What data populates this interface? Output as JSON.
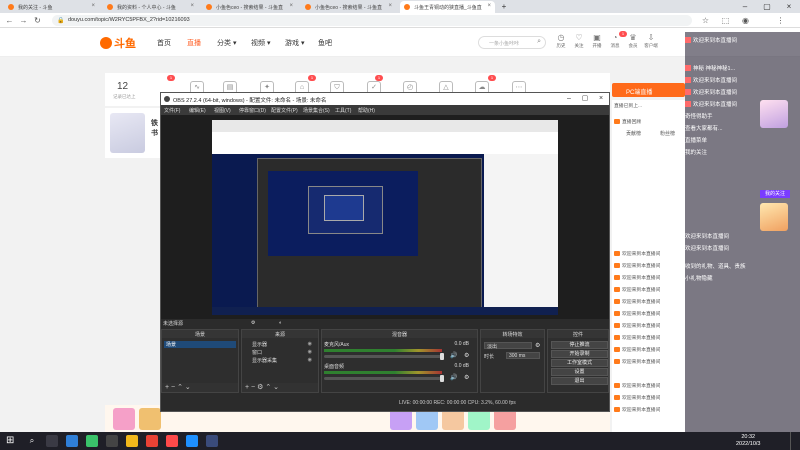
{
  "browser": {
    "tabs": [
      {
        "title": "我的关注 - 斗鱼"
      },
      {
        "title": "我的资料 - 个人中心 - 斗鱼"
      },
      {
        "title": "小鱼色ceo - 搜索结果 - 斗鱼直"
      },
      {
        "title": "小鱼色ceo - 搜索结果 - 斗鱼直"
      },
      {
        "title": "斗鱼王青铜动的狭直播_斗鱼直"
      }
    ],
    "url": "douyu.com/topic/W2RYC5PFBX_2?rid=10216093"
  },
  "site": {
    "logo": "斗鱼",
    "nav": [
      "首页",
      "直播",
      "分类",
      "视频",
      "游戏",
      "鱼吧"
    ],
    "nav_active": "直播",
    "search_placeholder": "一条小鱼咔咔",
    "header_icons": [
      "历史",
      "关注",
      "开播",
      "消息",
      "会员",
      "客户端"
    ],
    "header_badge": "1"
  },
  "streamer": {
    "number": "12",
    "number_label": "记录已达上",
    "name": "铁书",
    "tool_badges": [
      "1",
      "1",
      "1",
      "1"
    ],
    "right_button": "PC端直播"
  },
  "right_panel": {
    "top_note": "直播已到上...",
    "tabs": [
      "贡献榜",
      "粉丝榜"
    ],
    "messages": [
      "直播回顾",
      "欢迎来到本直播间",
      "欢迎来到本直播间",
      "欢迎来到本直播间",
      "欢迎来到本直播间",
      "欢迎来到本直播间",
      "欢迎来到本直播间",
      "欢迎来到本直播间",
      "欢迎来到本直播间",
      "欢迎来到本直播间",
      "欢迎来到本直播间",
      "欢迎来到本直播间",
      "欢迎来到本直播间",
      "欢迎来到本直播间"
    ]
  },
  "overlay": {
    "lines": [
      "欢迎来到本直播间",
      "神秘 神秘神秘1...",
      "欢迎来到本直播间",
      "欢迎来到本直播间",
      "欢迎来到本直播间",
      "奇怪得助手",
      "查看大家都有...",
      "直播菜单",
      "我的关注",
      "欢迎来到本直播间",
      "欢迎来到本直播间",
      "收到的礼物、道具、贵族",
      "小礼物隐藏"
    ],
    "side_label": "我的关注"
  },
  "obs": {
    "title": "OBS 27.2.4 (64-bit, windows) - 配置文件: 未命名 - 场景: 未命名",
    "menu": [
      "文件(F)",
      "编辑(E)",
      "视图(V)",
      "停靠窗口(D)",
      "配置文件(P)",
      "场景集合(S)",
      "工具(T)",
      "帮助(H)"
    ],
    "preview_label": "未选择源",
    "docks": {
      "scenes": {
        "title": "场景",
        "items": [
          "场景"
        ]
      },
      "sources": {
        "title": "来源",
        "items": [
          "显示器",
          "窗口",
          "显示器采集"
        ]
      },
      "mixer": {
        "title": "混音器",
        "channels": [
          {
            "name": "麦克风/Aux",
            "db": "0.0 dB"
          },
          {
            "name": "桌面音频",
            "db": "0.0 dB"
          }
        ]
      },
      "transitions": {
        "title": "转场特效",
        "type": "淡出",
        "duration_label": "时长",
        "duration": "300 ms"
      },
      "controls": {
        "title": "控件",
        "buttons": [
          "停止推流",
          "开始录制",
          "工作室模式",
          "设置",
          "退出"
        ]
      }
    },
    "status": "LIVE: 00:00:00   REC: 00:00:00   CPU: 3.2%, 60.00 fps"
  },
  "taskbar": {
    "time": "20:32",
    "date": "2022/10/3"
  }
}
